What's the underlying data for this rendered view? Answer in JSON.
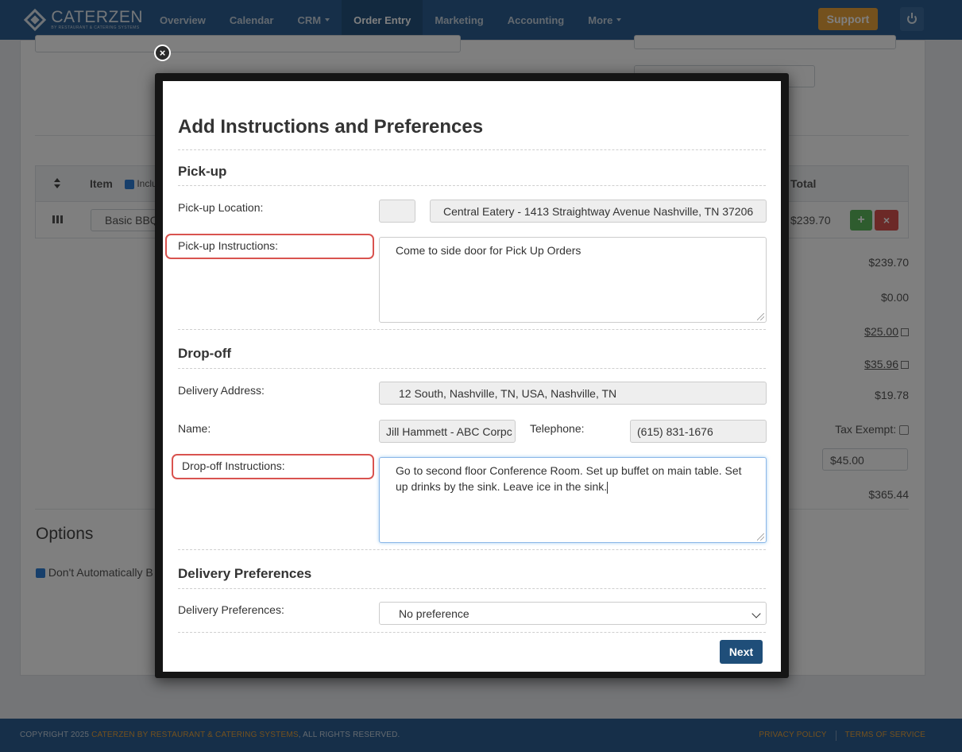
{
  "navbar": {
    "brand_name": "CATERZEN",
    "brand_sub": "BY RESTAURANT & CATERING SYSTEMS",
    "items": [
      {
        "label": "Overview"
      },
      {
        "label": "Calendar"
      },
      {
        "label": "CRM"
      },
      {
        "label": "Order Entry"
      },
      {
        "label": "Marketing"
      },
      {
        "label": "Accounting"
      },
      {
        "label": "More"
      }
    ],
    "support_label": "Support",
    "power_icon": "power-icon"
  },
  "background": {
    "table_item_header": "Item",
    "table_include_label": "Inclu",
    "table_total_header": "Total",
    "row_item": "Basic BBQ",
    "row_total": "$239.70",
    "summary": [
      "$239.70",
      "$0.00",
      "$25.00",
      "$35.96",
      "$19.78"
    ],
    "tax_exempt_label": "Tax Exempt:",
    "fee_input_value": "$45.00",
    "grand_total": "$365.44",
    "options_title": "Options",
    "options_checkbox_label": "Don't Automatically B"
  },
  "modal": {
    "title": "Add Instructions and Preferences",
    "pickup": {
      "section": "Pick-up",
      "location_label": "Pick-up Location:",
      "location_value": "Central Eatery - 1413 Straightway Avenue Nashville, TN 37206",
      "instructions_label": "Pick-up Instructions:",
      "instructions_value": "Come to side door for Pick Up Orders"
    },
    "dropoff": {
      "section": "Drop-off",
      "address_label": "Delivery Address:",
      "address_value": "12 South, Nashville, TN, USA, Nashville, TN",
      "name_label": "Name:",
      "name_value": "Jill Hammett - ABC Corpc",
      "telephone_label": "Telephone:",
      "telephone_value": "(615) 831-1676",
      "instructions_label": "Drop-off Instructions:",
      "instructions_value": "Go to second floor Conference Room. Set up buffet on main table. Set up drinks by the sink. Leave ice in the sink."
    },
    "preferences": {
      "section": "Delivery Preferences",
      "label": "Delivery Preferences:",
      "selected": "No preference"
    },
    "next_label": "Next",
    "close_glyph": "×"
  },
  "footer": {
    "copyright_prefix": "COPYRIGHT 2025 ",
    "copyright_link": "CATERZEN BY RESTAURANT & CATERING SYSTEMS",
    "copyright_suffix": ", ALL RIGHTS RESERVED.",
    "privacy": "PRIVACY POLICY",
    "terms": "TERMS OF SERVICE"
  },
  "colors": {
    "navbar": "#2c5f93",
    "support": "#e9a23b",
    "next_button": "#1f4e79",
    "highlight": "#d9534f"
  }
}
